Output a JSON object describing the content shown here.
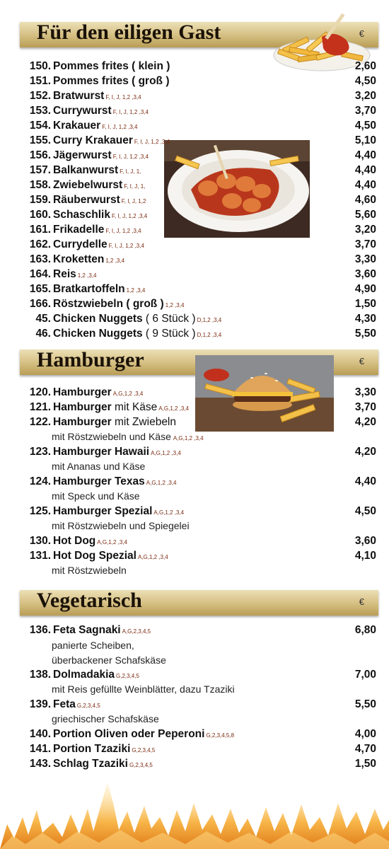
{
  "sections": {
    "fast": {
      "title": "Für den eiligen Gast",
      "currency": "€",
      "items": [
        {
          "num": "150.",
          "name": "Pommes frites ( klein )",
          "allergens": "",
          "price": "2,60"
        },
        {
          "num": "151.",
          "name": "Pommes frites ( groß )",
          "allergens": "",
          "price": "4,50"
        },
        {
          "num": "152.",
          "name": "Bratwurst",
          "allergens": "F, I, J, 1,2 ,3,4",
          "price": "3,20"
        },
        {
          "num": "153.",
          "name": "Currywurst",
          "allergens": "F, I, J, 1,2 ,3,4",
          "price": "3,70"
        },
        {
          "num": "154.",
          "name": "Krakauer",
          "allergens": "F, I, J, 1,2 ,3,4",
          "price": "4,50"
        },
        {
          "num": "155.",
          "name": "Curry Krakauer",
          "allergens": "F, I, J, 1,2 ,3,4",
          "price": "5,10"
        },
        {
          "num": "156.",
          "name": "Jägerwurst",
          "allergens": "F, I, J, 1,2 ,3,4",
          "price": "4,40"
        },
        {
          "num": "157.",
          "name": "Balkanwurst",
          "allergens": "F, I, J, 1,",
          "price": "4,40"
        },
        {
          "num": "158.",
          "name": "Zwiebelwurst",
          "allergens": "F, I, J, 1,",
          "price": "4,40"
        },
        {
          "num": "159.",
          "name": "Räuberwurst",
          "allergens": "F, I, J, 1,2",
          "price": "4,60"
        },
        {
          "num": "160.",
          "name": "Schaschlik",
          "allergens": "F, I, J, 1,2 ,3,4",
          "price": "5,60"
        },
        {
          "num": "161.",
          "name": "Frikadelle",
          "allergens": "F, I, J, 1,2 ,3,4",
          "price": "3,20"
        },
        {
          "num": "162.",
          "name": "Currydelle",
          "allergens": "F, I, J, 1,2 ,3,4",
          "price": "3,70"
        },
        {
          "num": "163.",
          "name": "Kroketten",
          "allergens": "1,2 ,3,4",
          "price": "3,30"
        },
        {
          "num": "164.",
          "name": "Reis",
          "allergens": "1,2 ,3,4",
          "price": "3,60"
        },
        {
          "num": "165.",
          "name": "Bratkartoffeln",
          "allergens": "1,2 ,3,4",
          "price": "4,90"
        },
        {
          "num": "166.",
          "name": "Röstzwiebeln ( groß )",
          "allergens": "1,2 ,3,4",
          "price": "1,50"
        },
        {
          "num": "45.",
          "name": "Chicken Nuggets",
          "light": "( 6 Stück )",
          "allergens": "D,1,2 ,3,4",
          "price": "4,30"
        },
        {
          "num": "46.",
          "name": "Chicken Nuggets",
          "light": "( 9 Stück )",
          "allergens": "D,1,2 ,3,4",
          "price": "5,50"
        }
      ]
    },
    "burger": {
      "title": "Hamburger",
      "currency": "€",
      "items": [
        {
          "num": "120.",
          "name": "Hamburger",
          "allergens": "A,G,1,2 ,3,4",
          "price": "3,30"
        },
        {
          "num": "121.",
          "name": "Hamburger",
          "light": "mit Käse",
          "allergens": "A,G,1,2 ,3,4",
          "price": "3,70"
        },
        {
          "num": "122.",
          "name": "Hamburger",
          "light": "mit Zwiebeln",
          "desc": "mit Röstzwiebeln und Käse",
          "desc_allergens": "A,G,1,2 ,3,4",
          "price": "4,20"
        },
        {
          "num": "123.",
          "name": "Hamburger Hawaii",
          "allergens": "A,G,1,2 ,3,4",
          "desc": "mit Ananas und Käse",
          "price": "4,20"
        },
        {
          "num": "124.",
          "name": "Hamburger Texas",
          "allergens": "A,G,1,2 ,3,4",
          "desc": "mit Speck und Käse",
          "price": "4,40"
        },
        {
          "num": "125.",
          "name": "Hamburger Spezial",
          "allergens": "A,G,1,2 ,3,4",
          "desc": "mit Röstzwiebeln und Spiegelei",
          "price": "4,50"
        },
        {
          "num": "130.",
          "name": "Hot Dog",
          "allergens": "A,G,1,2 ,3,4",
          "price": "3,60"
        },
        {
          "num": "131.",
          "name": "Hot Dog Spezial",
          "allergens": "A,G,1,2 ,3,4",
          "desc": "mit Röstzwiebeln",
          "price": "4,10"
        }
      ]
    },
    "veg": {
      "title": "Vegetarisch",
      "currency": "€",
      "items": [
        {
          "num": "136.",
          "name": "Feta Sagnaki",
          "allergens": "A,G,2,3,4,5",
          "desc": "panierte Scheiben,",
          "desc2": "überbackener Schafskäse",
          "price": "6,80"
        },
        {
          "num": "138.",
          "name": "Dolmadakia",
          "allergens": "G,2,3,4,5",
          "desc": "mit Reis gefüllte Weinblätter, dazu Tzaziki",
          "price": "7,00"
        },
        {
          "num": "139.",
          "name": "Feta",
          "allergens": "G,2,3,4,5",
          "desc": "griechischer Schafskäse",
          "price": "5,50"
        },
        {
          "num": "140.",
          "name": "Portion Oliven oder Peperoni",
          "allergens": "G,2,3,4,5,8",
          "price": "4,00"
        },
        {
          "num": "141.",
          "name": "Portion Tzaziki",
          "allergens": "G,2,3,4,5",
          "price": "4,70"
        },
        {
          "num": "143.",
          "name": "Schlag Tzaziki",
          "allergens": "G,2,3,4,5",
          "price": "1,50"
        }
      ]
    }
  },
  "images": {
    "fries": "fries-image",
    "currywurst": "currywurst-image",
    "burger": "burger-image",
    "flames": "flames-decoration"
  },
  "colors": {
    "banner_light": "#ece0b6",
    "banner_dark": "#b99d55",
    "allergen_text": "#7a2a10",
    "flame": "#f0a030"
  }
}
